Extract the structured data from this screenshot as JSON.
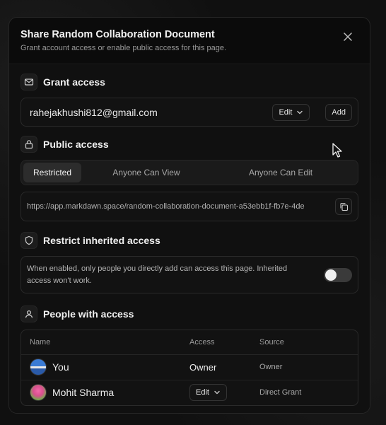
{
  "dialog": {
    "title": "Share Random Collaboration Document",
    "subtitle": "Grant account access or enable public access for this page."
  },
  "grant": {
    "title": "Grant access",
    "email_value": "rahejakhushi812@gmail.com",
    "permission_label": "Edit",
    "add_label": "Add"
  },
  "public": {
    "title": "Public access",
    "options": [
      "Restricted",
      "Anyone Can View",
      "Anyone Can Edit"
    ],
    "selected": "Restricted",
    "link": "https://app.markdawn.space/random-collaboration-document-a53ebb1f-fb7e-4de"
  },
  "restrict": {
    "title": "Restrict inherited access",
    "description": "When enabled, only people you directly add can access this page. Inherited access won't work.",
    "enabled": false
  },
  "people": {
    "title": "People with access",
    "columns": [
      "Name",
      "Access",
      "Source"
    ],
    "rows": [
      {
        "name": "You",
        "access": "Owner",
        "source": "Owner"
      },
      {
        "name": "Mohit Sharma",
        "access": "Edit",
        "source": "Direct Grant"
      }
    ]
  },
  "icons": {
    "close": "close-icon",
    "mail": "mail-icon",
    "lock": "lock-icon",
    "shield": "shield-icon",
    "user": "user-icon",
    "copy": "copy-icon",
    "chevron": "chevron-down-icon"
  }
}
